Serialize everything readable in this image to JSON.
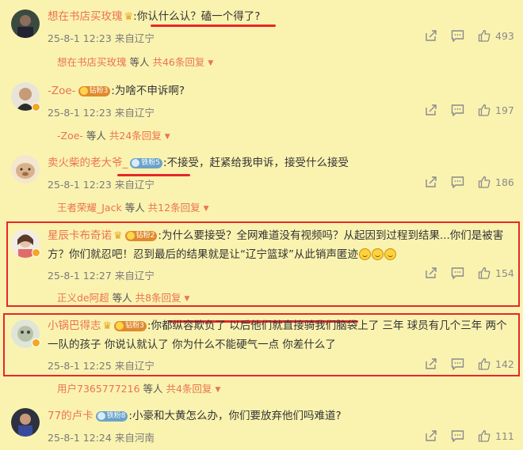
{
  "comments": [
    {
      "user": "想在书店买玫瑰",
      "badge": "",
      "text": ":你认什么认？磕一个得了?",
      "time": "25-8-1 12:23",
      "location": "来自辽宁",
      "likes": "493",
      "reply_user": "想在书店买玫瑰",
      "reply_mid": " 等人 ",
      "reply_count": "共46条回复"
    },
    {
      "user": "-Zoe-",
      "badge": "钻粉3",
      "text": ":为啥不申诉啊?",
      "time": "25-8-1 12:23",
      "location": "来自辽宁",
      "likes": "197",
      "reply_user": "-Zoe-",
      "reply_mid": " 等人 ",
      "reply_count": "共24条回复"
    },
    {
      "user": "卖火柴的老大爷_",
      "badge": "铁粉5",
      "text": ":不接受，赶紧给我申诉，接受什么接受",
      "time": "25-8-1 12:23",
      "location": "来自辽宁",
      "likes": "186",
      "reply_user": "王者荣耀_Jack",
      "reply_mid": " 等人 ",
      "reply_count": "共12条回复"
    },
    {
      "user": "星辰卡布奇诺",
      "badge": "钻粉2",
      "text": ":为什么要接受？全网难道没有视频吗？从起因到过程到结果...你们是被害",
      "text2": "方？你们就忍吧！忍到最后的结果就是让“辽宁篮球”从此销声匿迹",
      "time": "25-8-1 12:27",
      "location": "来自辽宁",
      "likes": "154",
      "reply_user": "正义de阿超",
      "reply_mid": " 等人 ",
      "reply_count": "共8条回复"
    },
    {
      "user": "小锅巴得志",
      "badge": "钻粉3",
      "text": ":你都纵容欺负了 以后他们就直接骑我们脑袋上了 三年 球员有几个三年 两个",
      "text2": "一队的孩子 你说认就认了 你为什么不能硬气一点 你差什么了",
      "time": "25-8-1 12:25",
      "location": "来自辽宁",
      "likes": "142",
      "reply_user": "用户7365777216",
      "reply_mid": " 等人 ",
      "reply_count": "共4条回复"
    },
    {
      "user": "77的卢卡",
      "badge": "铁粉8",
      "text": ":小豪和大黄怎么办，你们要放弃他们吗难道?",
      "time": "25-8-1 12:24",
      "location": "来自河南",
      "likes": "111"
    }
  ],
  "icons": {
    "share": "share-icon",
    "comment": "comment-icon",
    "like": "thumbs-up-icon",
    "expand": "triangle-down-icon"
  },
  "colors": {
    "background": "#faf3b0",
    "username": "#eb7350",
    "highlight": "#e8262c"
  }
}
